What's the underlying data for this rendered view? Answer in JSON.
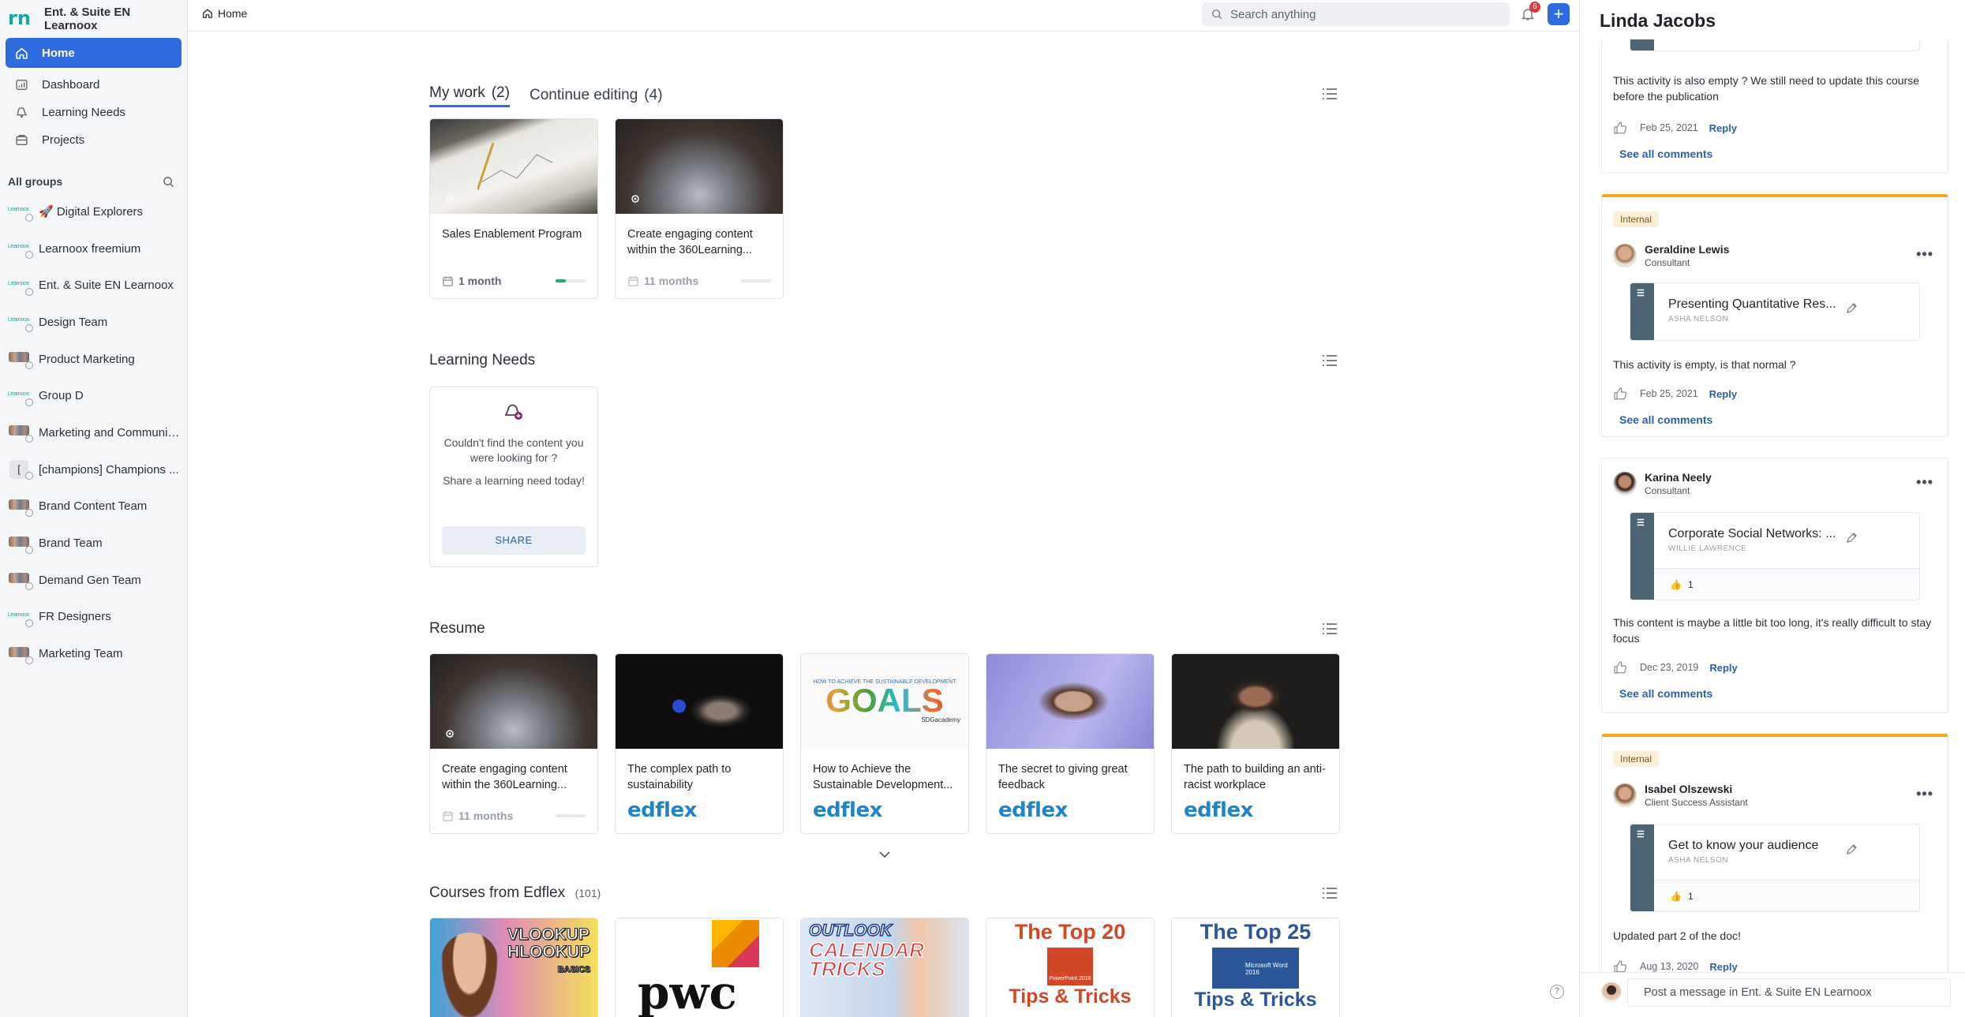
{
  "workspace": {
    "name": "Ent. & Suite EN Learnoox",
    "logo": "rn"
  },
  "nav": [
    {
      "label": "Home",
      "icon": "home-icon",
      "active": true
    },
    {
      "label": "Dashboard",
      "icon": "dashboard-icon"
    },
    {
      "label": "Learning Needs",
      "icon": "learning-needs-icon"
    },
    {
      "label": "Projects",
      "icon": "projects-icon"
    }
  ],
  "groups": {
    "title": "All groups",
    "items": [
      {
        "label": "🚀 Digital Explorers",
        "avatar": "mini"
      },
      {
        "label": "Learnoox freemium",
        "avatar": "mini"
      },
      {
        "label": "Ent. & Suite EN Learnoox",
        "avatar": "mini"
      },
      {
        "label": "Design Team",
        "avatar": "mini"
      },
      {
        "label": "Product Marketing",
        "avatar": "photo"
      },
      {
        "label": "Group D",
        "avatar": "mini"
      },
      {
        "label": "Marketing and Communic...",
        "avatar": "photo"
      },
      {
        "label": "[champions] Champions ...",
        "avatar": "box"
      },
      {
        "label": "Brand Content Team",
        "avatar": "photo"
      },
      {
        "label": "Brand Team",
        "avatar": "photo"
      },
      {
        "label": "Demand Gen Team",
        "avatar": "photo"
      },
      {
        "label": "FR Designers",
        "avatar": "mini"
      },
      {
        "label": "Marketing Team",
        "avatar": "photo"
      }
    ],
    "mini_text": "Learnoox"
  },
  "topbar": {
    "breadcrumb": "Home",
    "search_placeholder": "Search anything",
    "notifications": "6",
    "add": "+"
  },
  "my_work": {
    "tabs": [
      {
        "label": "My work",
        "count": "(2)",
        "active": true
      },
      {
        "label": "Continue editing",
        "count": "(4)"
      }
    ],
    "cards": [
      {
        "title": "Sales Enablement Program",
        "duration": "1 month",
        "progress": 0.35,
        "thumb": "paper"
      },
      {
        "title": "Create engaging content within the 360Learning...",
        "duration": "11 months",
        "progress": 0,
        "thumb": "laptop"
      }
    ]
  },
  "learning_needs": {
    "title": "Learning Needs",
    "text1": "Couldn't find the content you were looking for ?",
    "text2": "Share a learning need today!",
    "button": "SHARE"
  },
  "resume": {
    "title": "Resume",
    "cards": [
      {
        "title": "Create engaging content within the 360Learning...",
        "duration": "11 months",
        "thumb": "laptop",
        "source": ""
      },
      {
        "title": "The complex path to sustainability",
        "thumb": "stage",
        "source": "edflex"
      },
      {
        "title": "How to Achieve the Sustainable Development...",
        "thumb": "goals",
        "source": "edflex"
      },
      {
        "title": "The secret to giving great feedback",
        "thumb": "woman-purple",
        "source": "edflex"
      },
      {
        "title": "The path to building an anti-racist workplace",
        "thumb": "woman-dark",
        "source": "edflex"
      }
    ],
    "goals_text": "GOALS",
    "goals_sub": "HOW TO ACHIEVE THE SUSTAINABLE DEVELOPMENT",
    "goals_brand": "SDGacademy"
  },
  "courses": {
    "title": "Courses from Edflex",
    "count": "(101)",
    "thumbs": [
      {
        "line1": "VLOOKUP",
        "line2": "HLOOKUP",
        "line3": "BASICS"
      },
      {
        "line1": "pwc"
      },
      {
        "line1": "OUTLOOK",
        "line2": "CALENDAR",
        "line3": "TRICKS"
      },
      {
        "line1": "The Top 20",
        "line2": "Tips & Tricks",
        "line3": "PowerPoint 2016"
      },
      {
        "line1": "The Top 25",
        "line2": "Tips & Tricks",
        "line3": "Microsoft Word 2016"
      }
    ]
  },
  "panel": {
    "title": "Linda Jacobs",
    "top_comment": {
      "text": "This activity is also empty ? We still need to update this course before the publication",
      "date": "Feb 25, 2021",
      "reply": "Reply",
      "see_all": "See all comments"
    },
    "feed": [
      {
        "tag": "Internal",
        "author": "Geraldine Lewis",
        "role": "Consultant",
        "content_title": "Presenting Quantitative Res...",
        "content_author": "ASHA NELSON",
        "likes": "",
        "comment": "This activity is empty, is that normal ?",
        "date": "Feb 25, 2021",
        "reply": "Reply",
        "see_all": "See all comments"
      },
      {
        "tag": "",
        "author": "Karina Neely",
        "role": "Consultant",
        "content_title": "Corporate Social Networks: ...",
        "content_author": "WILLIE LAWRENCE",
        "likes": "1",
        "comment": "This content is maybe a little bit too long, it's really difficult to stay focus",
        "date": "Dec 23, 2019",
        "reply": "Reply",
        "see_all": "See all comments"
      },
      {
        "tag": "Internal",
        "author": "Isabel Olszewski",
        "role": "Client Success Assistant",
        "content_title": "Get to know your audience",
        "content_author": "ASHA NELSON",
        "likes": "1",
        "comment": "Updated part 2 of the doc!",
        "date": "Aug 13, 2020",
        "reply": "Reply",
        "see_all": ""
      }
    ],
    "post_placeholder": "Post a message in Ent. & Suite EN Learnoox"
  },
  "help": "?"
}
